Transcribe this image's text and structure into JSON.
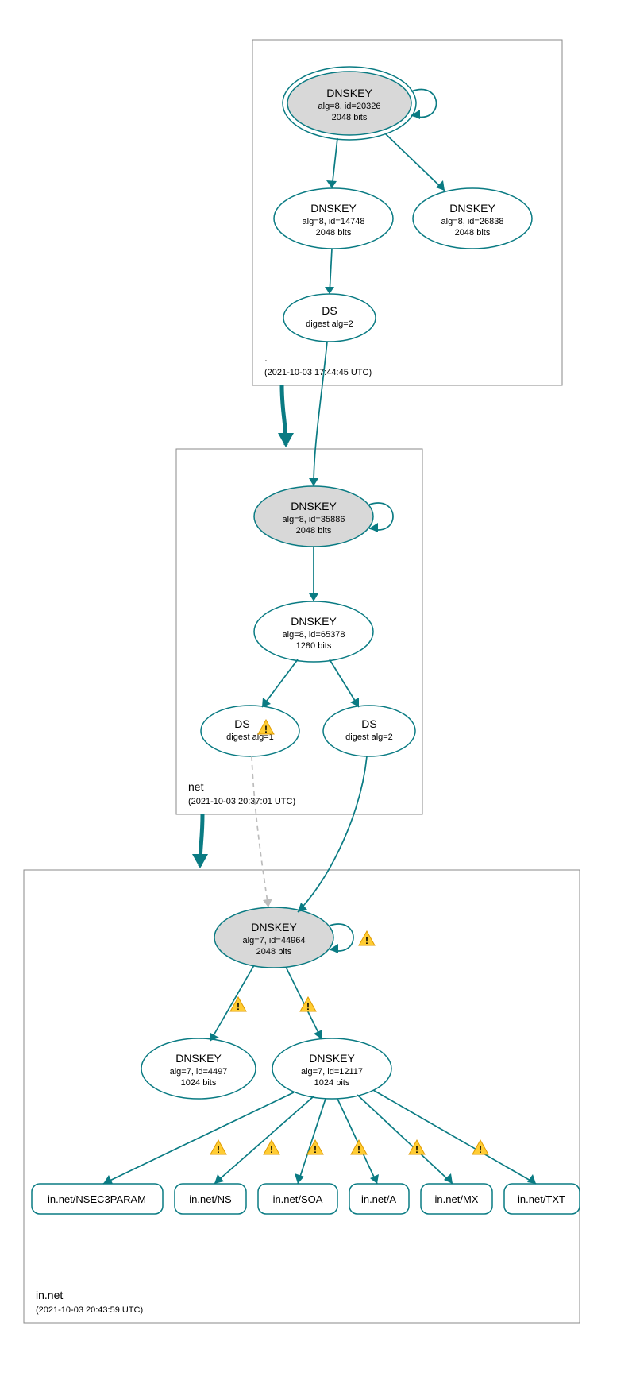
{
  "zones": {
    "root": {
      "label": ".",
      "timestamp": "(2021-10-03 17:44:45 UTC)"
    },
    "net": {
      "label": "net",
      "timestamp": "(2021-10-03 20:37:01 UTC)"
    },
    "innet": {
      "label": "in.net",
      "timestamp": "(2021-10-03 20:43:59 UTC)"
    }
  },
  "nodes": {
    "root_ksk": {
      "title": "DNSKEY",
      "line1": "alg=8, id=20326",
      "line2": "2048 bits"
    },
    "root_zsk1": {
      "title": "DNSKEY",
      "line1": "alg=8, id=14748",
      "line2": "2048 bits"
    },
    "root_zsk2": {
      "title": "DNSKEY",
      "line1": "alg=8, id=26838",
      "line2": "2048 bits"
    },
    "root_ds": {
      "title": "DS",
      "line1": "digest alg=2",
      "line2": ""
    },
    "net_ksk": {
      "title": "DNSKEY",
      "line1": "alg=8, id=35886",
      "line2": "2048 bits"
    },
    "net_zsk": {
      "title": "DNSKEY",
      "line1": "alg=8, id=65378",
      "line2": "1280 bits"
    },
    "net_ds1": {
      "title": "DS",
      "line1": "digest alg=1",
      "line2": ""
    },
    "net_ds2": {
      "title": "DS",
      "line1": "digest alg=2",
      "line2": ""
    },
    "innet_ksk": {
      "title": "DNSKEY",
      "line1": "alg=7, id=44964",
      "line2": "2048 bits"
    },
    "innet_zsk1": {
      "title": "DNSKEY",
      "line1": "alg=7, id=4497",
      "line2": "1024 bits"
    },
    "innet_zsk2": {
      "title": "DNSKEY",
      "line1": "alg=7, id=12117",
      "line2": "1024 bits"
    }
  },
  "rr": {
    "nsec3param": "in.net/NSEC3PARAM",
    "ns": "in.net/NS",
    "soa": "in.net/SOA",
    "a": "in.net/A",
    "mx": "in.net/MX",
    "txt": "in.net/TXT"
  }
}
